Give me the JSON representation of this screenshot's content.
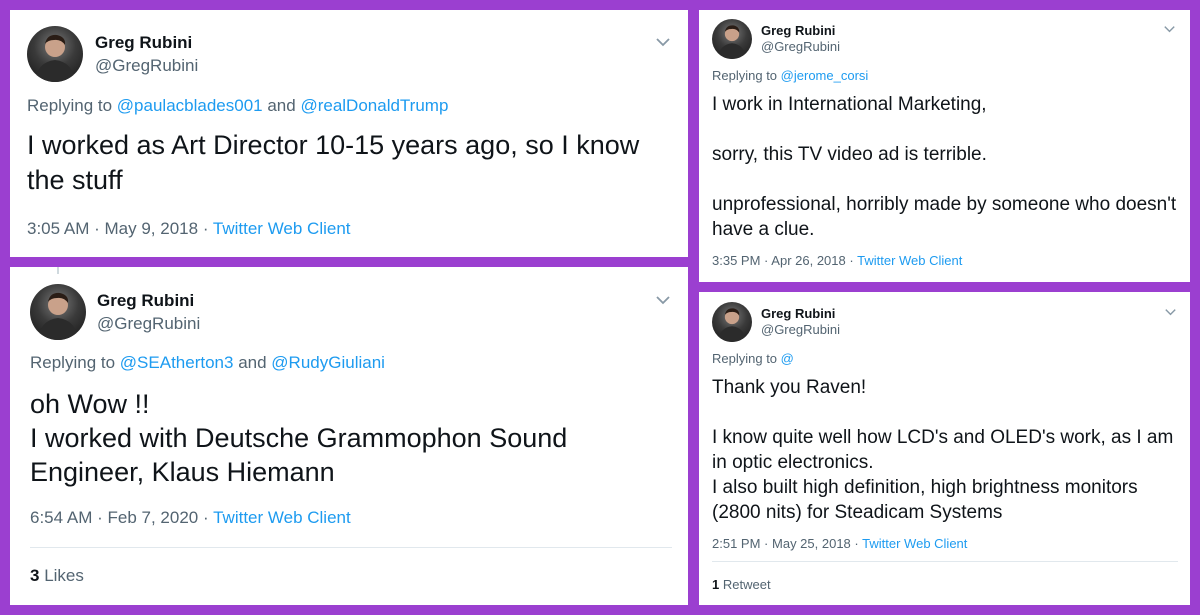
{
  "tweets": [
    {
      "name": "Greg Rubini",
      "handle": "@GregRubini",
      "replying_prefix": "Replying to",
      "reply_to": [
        "@paulacblades001",
        "@realDonaldTrump"
      ],
      "reply_joiner": "and",
      "lines": [
        "I worked as Art Director 10-15 years ago, so I know the stuff"
      ],
      "time": "3:05 AM",
      "date": "May 9, 2018",
      "client": "Twitter Web Client"
    },
    {
      "name": "Greg Rubini",
      "handle": "@GregRubini",
      "replying_prefix": "Replying to",
      "reply_to": [
        "@SEAtherton3",
        "@RudyGiuliani"
      ],
      "reply_joiner": "and",
      "lines": [
        "oh Wow !!",
        "I worked with Deutsche Grammophon Sound Engineer, Klaus Hiemann"
      ],
      "time": "6:54 AM",
      "date": "Feb 7, 2020",
      "client": "Twitter Web Client",
      "stat_count": "3",
      "stat_label": "Likes"
    },
    {
      "name": "Greg Rubini",
      "handle": "@GregRubini",
      "replying_prefix": "Replying to",
      "reply_to": [
        "@jerome_corsi"
      ],
      "lines": [
        "I work in International Marketing,",
        "",
        "sorry, this TV video ad is terrible.",
        "",
        "unprofessional, horribly made by someone who doesn't have a clue."
      ],
      "time": "3:35 PM",
      "date": "Apr 26, 2018",
      "client": "Twitter Web Client"
    },
    {
      "name": "Greg Rubini",
      "handle": "@GregRubini",
      "replying_prefix": "Replying to",
      "reply_to": [
        "@"
      ],
      "lines": [
        "Thank you Raven!",
        "",
        "I know quite well how LCD's and OLED's work, as I am in optic electronics.",
        "I also built high definition, high brightness monitors (2800 nits) for Steadicam Systems"
      ],
      "time": "2:51 PM",
      "date": "May 25, 2018",
      "client": "Twitter Web Client",
      "stat_count": "1",
      "stat_label": "Retweet"
    }
  ],
  "separator": "·",
  "colors": {
    "background": "#9b3fd0",
    "card": "#ffffff",
    "link": "#1d9bf0",
    "secondary_text": "#536471",
    "primary_text": "#0f1419"
  },
  "icons": {
    "avatar": "profile-photo",
    "caret": "chevron-down-icon"
  }
}
